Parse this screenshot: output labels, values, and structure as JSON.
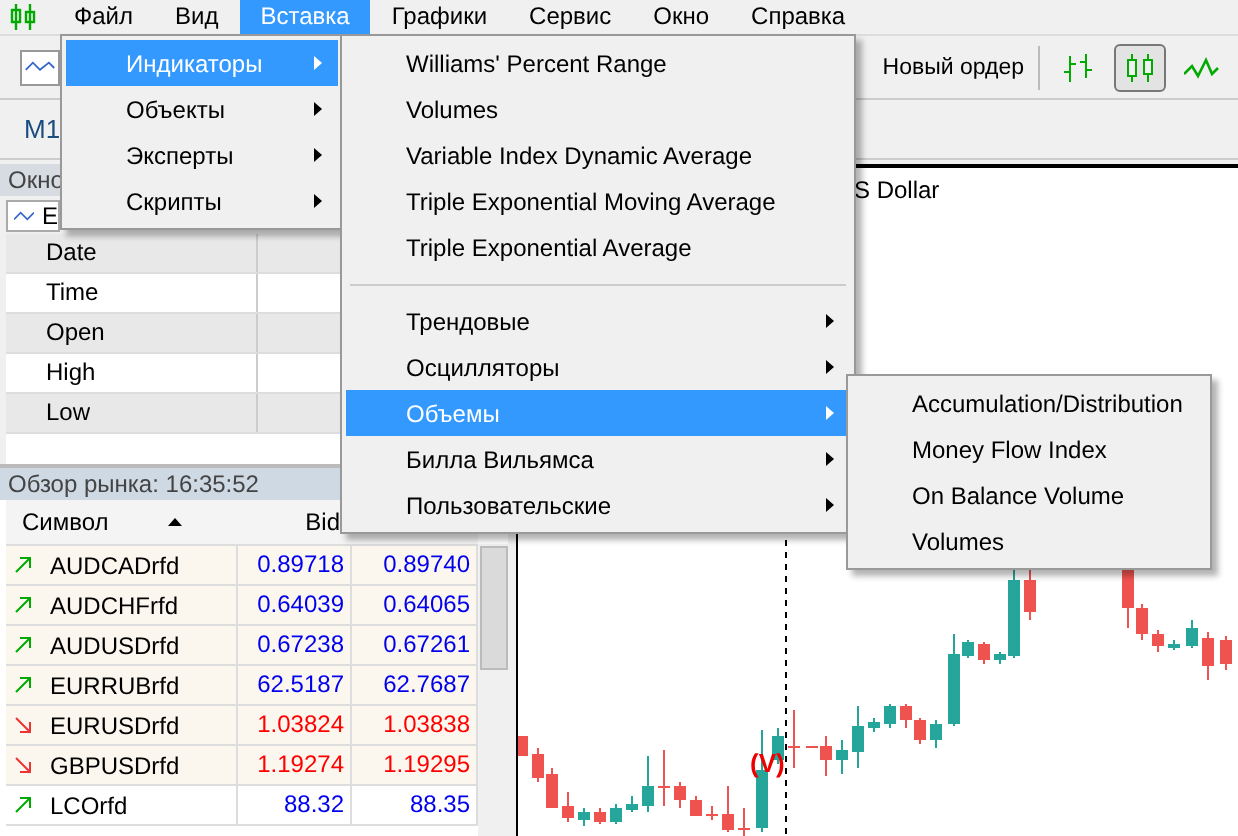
{
  "menubar": [
    {
      "label": "Файл",
      "selected": false
    },
    {
      "label": "Вид",
      "selected": false
    },
    {
      "label": "Вставка",
      "selected": true
    },
    {
      "label": "Графики",
      "selected": false
    },
    {
      "label": "Сервис",
      "selected": false
    },
    {
      "label": "Окно",
      "selected": false
    },
    {
      "label": "Справка",
      "selected": false
    }
  ],
  "toolbar": {
    "new_order": "Новый ордер",
    "chart_types": [
      {
        "kind": "bars",
        "selected": false
      },
      {
        "kind": "candles",
        "selected": true
      },
      {
        "kind": "line",
        "selected": false
      }
    ]
  },
  "timeframe": "M1",
  "data_window": {
    "title": "Окно",
    "selector": "E",
    "rows": [
      "Date",
      "Time",
      "Open",
      "High",
      "Low"
    ]
  },
  "market_watch": {
    "title": "Обзор рынка: 16:35:52",
    "columns": [
      "Символ",
      "Bid"
    ],
    "rows": [
      {
        "symbol": "AUDCADrfd",
        "bid": "0.89718",
        "ask": "0.89740",
        "rising": true
      },
      {
        "symbol": "AUDCHFrfd",
        "bid": "0.64039",
        "ask": "0.64065",
        "rising": true
      },
      {
        "symbol": "AUDUSDrfd",
        "bid": "0.67238",
        "ask": "0.67261",
        "rising": true
      },
      {
        "symbol": "EURRUBrfd",
        "bid": "62.5187",
        "ask": "62.7687",
        "rising": true
      },
      {
        "symbol": "EURUSDrfd",
        "bid": "1.03824",
        "ask": "1.03838",
        "rising": false
      },
      {
        "symbol": "GBPUSDrfd",
        "bid": "1.19274",
        "ask": "1.19295",
        "rising": false
      },
      {
        "symbol": "LCOrfd",
        "bid": "88.32",
        "ask": "88.35",
        "rising": true
      }
    ]
  },
  "chart": {
    "title": "S Dollar",
    "signal": "(V)"
  },
  "insert_menu": [
    {
      "label": "Индикаторы",
      "selected": true
    },
    {
      "label": "Объекты",
      "selected": false
    },
    {
      "label": "Эксперты",
      "selected": false
    },
    {
      "label": "Скрипты",
      "selected": false
    }
  ],
  "indicators_menu": {
    "indicators": [
      {
        "label": "Williams' Percent Range",
        "selected": false
      },
      {
        "label": "Volumes",
        "selected": false
      },
      {
        "label": "Variable Index Dynamic Average",
        "selected": false
      },
      {
        "label": "Triple Exponential Moving Average",
        "selected": false
      },
      {
        "label": "Triple Exponential Average",
        "selected": false
      }
    ],
    "categories": [
      {
        "label": "Трендовые",
        "selected": false
      },
      {
        "label": "Осцилляторы",
        "selected": false
      },
      {
        "label": "Объемы",
        "selected": true
      },
      {
        "label": "Билла Вильямса",
        "selected": false
      },
      {
        "label": "Пользовательские",
        "selected": false
      }
    ]
  },
  "volumes_menu": [
    {
      "label": "Accumulation/Distribution",
      "selected": false
    },
    {
      "label": "Money Flow Index",
      "selected": false
    },
    {
      "label": "On Balance Volume",
      "selected": false
    },
    {
      "label": "Volumes",
      "selected": false
    }
  ]
}
